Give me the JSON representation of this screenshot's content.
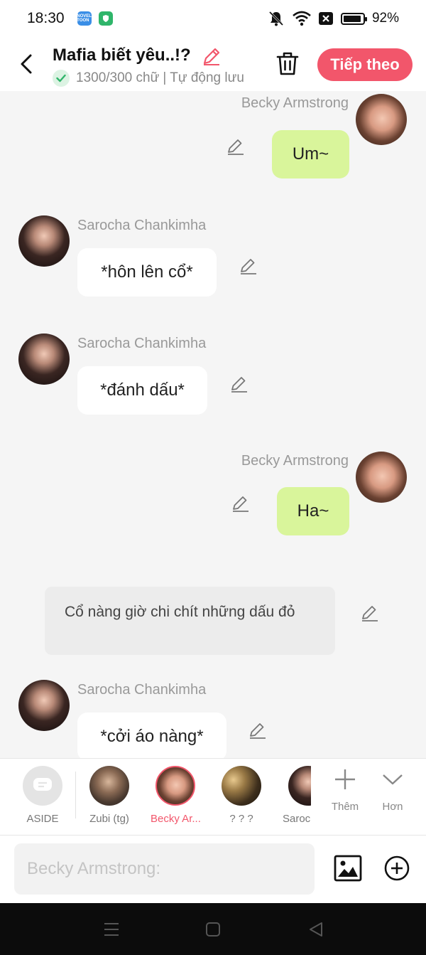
{
  "status_bar": {
    "time": "18:30",
    "battery_text": "92%",
    "battery_level": 0.92,
    "app_icons": [
      "novel-toon-icon",
      "shield-app-icon"
    ],
    "novel_icon_text": "NOVEL TOON"
  },
  "header": {
    "title": "Mafia biết yêu..!?",
    "word_count": "1300/300 chữ",
    "separator": "|",
    "autosave": "Tự động lưu",
    "next_button": "Tiếp theo"
  },
  "colors": {
    "accent": "#f2566b",
    "bubble_green": "#d9f59b",
    "bubble_white": "#ffffff",
    "aside_bg": "#ececec",
    "background": "#f5f5f5"
  },
  "messages": [
    {
      "speaker": "Becky Armstrong",
      "side": "right",
      "text": "Um~"
    },
    {
      "speaker": "Sarocha Chankimha",
      "side": "left",
      "text": "*hôn lên cổ*"
    },
    {
      "speaker": "Sarocha Chankimha",
      "side": "left",
      "text": "*đánh dấu*"
    },
    {
      "speaker": "Becky Armstrong",
      "side": "right",
      "text": "Ha~"
    },
    {
      "speaker": "",
      "side": "aside",
      "text": "Cổ nàng giờ chi chít những dấu đỏ"
    },
    {
      "speaker": "Sarocha Chankimha",
      "side": "left",
      "text": "*cởi áo nàng*"
    }
  ],
  "characters": [
    {
      "label": "ASIDE",
      "selected": false
    },
    {
      "label": "Zubi (tg)",
      "selected": false
    },
    {
      "label": "Becky Ar...",
      "selected": true
    },
    {
      "label": "? ? ?",
      "selected": false
    },
    {
      "label": "Saroc",
      "selected": false
    }
  ],
  "actions": {
    "add": "Thêm",
    "more": "Hơn"
  },
  "input": {
    "placeholder": "Becky Armstrong:"
  }
}
